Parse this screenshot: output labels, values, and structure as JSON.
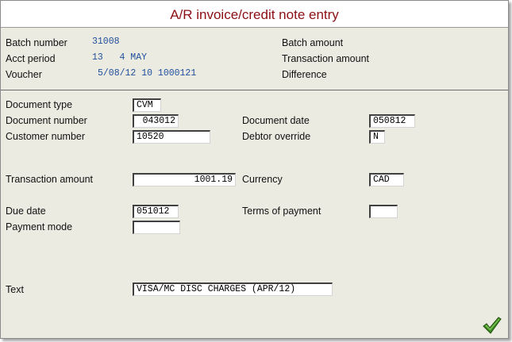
{
  "title": "A/R invoice/credit note entry",
  "header": {
    "batch_number_label": "Batch number",
    "batch_number": "31008",
    "acct_period_label": "Acct period",
    "acct_period": "13   4 MAY",
    "voucher_label": "Voucher",
    "voucher": "5/08/12 10 1000121",
    "batch_amount_label": "Batch amount",
    "transaction_amount_label": "Transaction amount",
    "difference_label": "Difference"
  },
  "form": {
    "document_type_label": "Document type",
    "document_type": "CVM",
    "document_number_label": "Document number",
    "document_number": "043012",
    "document_date_label": "Document date",
    "document_date": "050812",
    "customer_number_label": "Customer number",
    "customer_number": "10520",
    "debtor_override_label": "Debtor override",
    "debtor_override": "N",
    "transaction_amount_label": "Transaction amount",
    "transaction_amount": "1001.19",
    "currency_label": "Currency",
    "currency": "CAD",
    "due_date_label": "Due date",
    "due_date": "051012",
    "terms_of_payment_label": "Terms of payment",
    "terms_of_payment": "",
    "payment_mode_label": "Payment mode",
    "payment_mode": "",
    "text_label": "Text",
    "text": "VISA/MC DISC CHARGES (APR/12)"
  },
  "icons": {
    "ok": "checkmark-icon"
  },
  "colors": {
    "title": "#8b0f14",
    "value": "#1f4f9c",
    "background": "#ecebe2",
    "checkmark": "#3e8b1f"
  }
}
